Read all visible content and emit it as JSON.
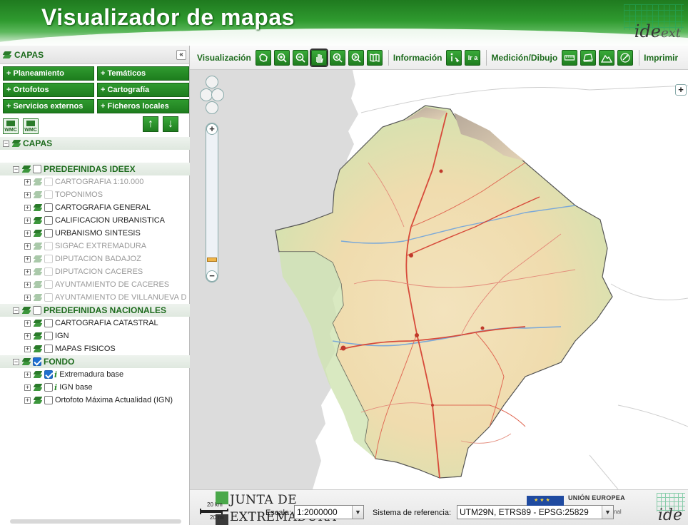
{
  "header": {
    "title": "Visualizador de mapas",
    "logo_text": "ide",
    "logo_suffix": "ext"
  },
  "panel": {
    "title": "CAPAS",
    "collapse_label": "«",
    "categories": [
      "+ Planeamiento",
      "+ Temáticos",
      "+ Ortofotos",
      "+ Cartografía",
      "+ Servicios externos",
      "+ Ficheros locales"
    ],
    "wmc_label": "WMC",
    "up_label": "↑",
    "down_label": "↓",
    "tree": [
      {
        "level": 0,
        "kind": "root",
        "label": "CAPAS",
        "checkbox": false
      },
      {
        "level": 1,
        "kind": "group",
        "label": "PREDEFINIDAS IDEEX",
        "checkbox": true,
        "checked": false
      },
      {
        "level": 2,
        "kind": "layer",
        "label": "CARTOGRAFIA 1:10.000",
        "dim": true,
        "checked": false
      },
      {
        "level": 2,
        "kind": "layer",
        "label": "TOPONIMOS",
        "dim": true,
        "checked": false
      },
      {
        "level": 2,
        "kind": "layer",
        "label": "CARTOGRAFIA GENERAL",
        "dim": false,
        "checked": false
      },
      {
        "level": 2,
        "kind": "layer",
        "label": " CALIFICACION URBANISTICA",
        "dim": false,
        "checked": false
      },
      {
        "level": 2,
        "kind": "layer",
        "label": " URBANISMO SINTESIS",
        "dim": false,
        "checked": false
      },
      {
        "level": 2,
        "kind": "layer",
        "label": " SIGPAC EXTREMADURA",
        "dim": true,
        "checked": false
      },
      {
        "level": 2,
        "kind": "layer",
        "label": "DIPUTACION BADAJOZ",
        "dim": true,
        "checked": false
      },
      {
        "level": 2,
        "kind": "layer",
        "label": "DIPUTACION CACERES",
        "dim": true,
        "checked": false
      },
      {
        "level": 2,
        "kind": "layer",
        "label": " AYUNTAMIENTO DE CACERES",
        "dim": true,
        "checked": false
      },
      {
        "level": 2,
        "kind": "layer",
        "label": " AYUNTAMIENTO DE VILLANUEVA D",
        "dim": true,
        "checked": false
      },
      {
        "level": 1,
        "kind": "group",
        "label": "PREDEFINIDAS NACIONALES",
        "checkbox": true,
        "checked": false
      },
      {
        "level": 2,
        "kind": "layer",
        "label": "CARTOGRAFIA CATASTRAL",
        "dim": false,
        "checked": false
      },
      {
        "level": 2,
        "kind": "layer",
        "label": "IGN",
        "dim": false,
        "checked": false
      },
      {
        "level": 2,
        "kind": "layer",
        "label": "MAPAS FISICOS",
        "dim": false,
        "checked": false
      },
      {
        "level": 1,
        "kind": "group",
        "label": "FONDO",
        "checkbox": true,
        "checked": true
      },
      {
        "level": 2,
        "kind": "base",
        "label": " Extremadura base",
        "dim": false,
        "checked": true,
        "info": true
      },
      {
        "level": 2,
        "kind": "base",
        "label": " IGN base",
        "dim": false,
        "checked": false,
        "info": true
      },
      {
        "level": 2,
        "kind": "base",
        "label": "Ortofoto Máxima Actualidad (IGN)",
        "dim": false,
        "checked": false,
        "info": false
      }
    ]
  },
  "toolbar": {
    "visualizacion": "Visualización",
    "informacion": "Información",
    "ir_a": "Ir a",
    "medicion": "Medición/Dibujo",
    "imprimir": "Imprimir"
  },
  "map": {
    "zoom_in": "+",
    "zoom_out": "−",
    "expand": "+"
  },
  "footer": {
    "junta_line1": "JUNTA DE",
    "junta_line2": "EXTREMADURA",
    "scale_km": "20 km",
    "scale_mi": "20 mi",
    "escala_label": "Escala:",
    "escala_value": "1:2000000",
    "sr_label": "Sistema de referencia:",
    "sr_value": "UTM29N, ETRS89 - EPSG:25829",
    "eu_title": "UNIÓN EUROPEA",
    "eu_sub": "nal",
    "ide_text": "ide"
  },
  "colors": {
    "brand_green": "#1f7d1f",
    "accent_orange": "#f0b64a",
    "checkbox_blue": "#1f6fd1"
  }
}
